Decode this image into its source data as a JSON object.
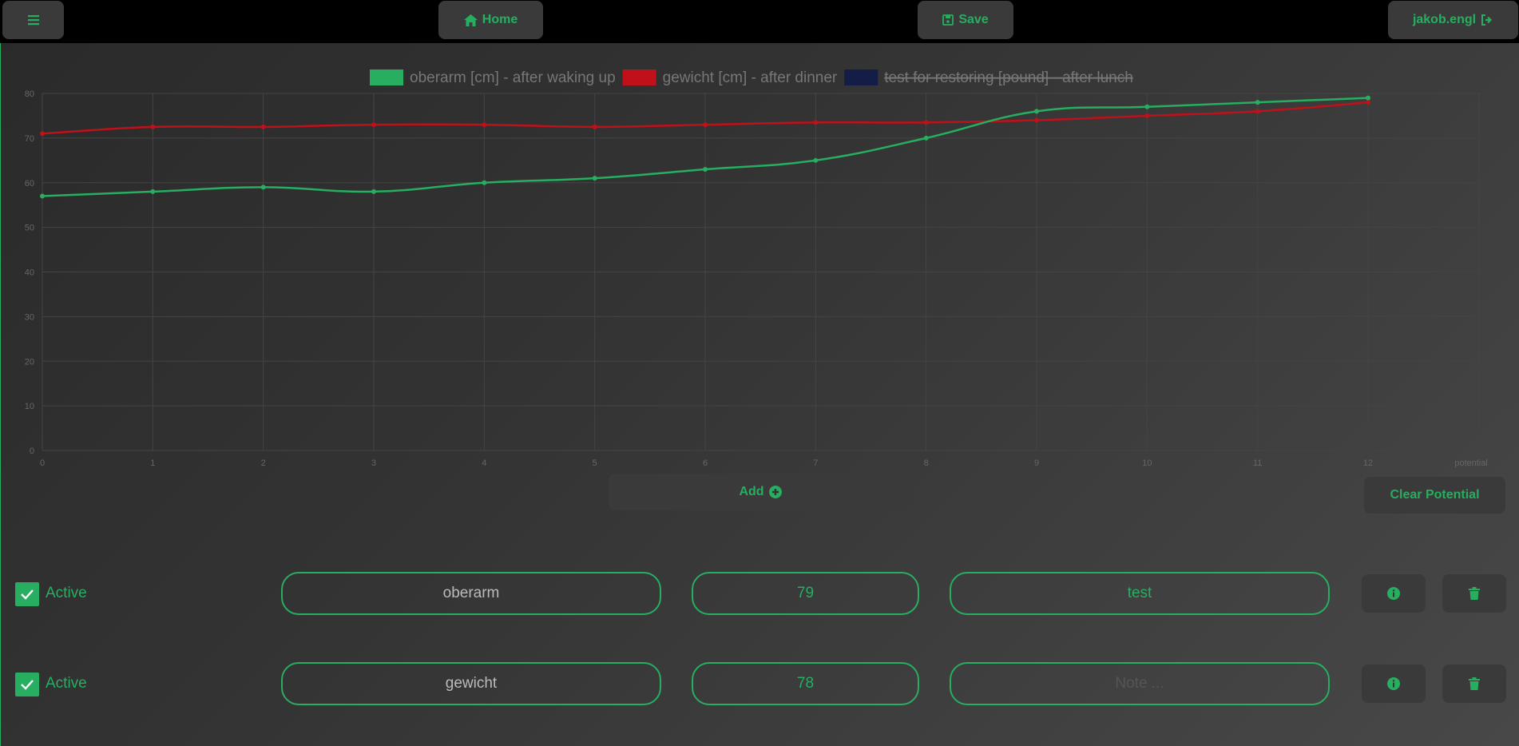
{
  "topbar": {
    "menu_icon": "bars-icon",
    "home_label": "Home",
    "save_label": "Save",
    "user_label": "jakob.engl"
  },
  "chart_data": {
    "type": "line",
    "x": [
      0,
      1,
      2,
      3,
      4,
      5,
      6,
      7,
      8,
      9,
      10,
      11,
      12
    ],
    "xlabel": "potential",
    "ylim": [
      0,
      80
    ],
    "yticks": [
      0,
      10,
      20,
      30,
      40,
      50,
      60,
      70,
      80
    ],
    "grid": true,
    "legend_position": "top",
    "series": [
      {
        "name": "oberarm [cm] - after waking up",
        "color": "#27ae60",
        "hidden": false,
        "values": [
          57,
          58,
          59,
          58,
          60,
          61,
          63,
          65,
          70,
          76,
          77,
          78,
          79
        ]
      },
      {
        "name": "gewicht [cm] - after dinner",
        "color": "#c0101a",
        "hidden": false,
        "values": [
          71,
          72.5,
          72.5,
          73,
          73,
          72.5,
          73,
          73.5,
          73.5,
          74,
          75,
          76,
          78
        ]
      },
      {
        "name": "test for restoring [pound] - after lunch",
        "color": "#131d45",
        "hidden": true,
        "values": []
      }
    ]
  },
  "actions": {
    "add_label": "Add",
    "clear_label": "Clear Potential"
  },
  "rows": [
    {
      "active_label": "Active",
      "name": "oberarm",
      "value": "79",
      "note": "test",
      "note_placeholder": "Note ..."
    },
    {
      "active_label": "Active",
      "name": "gewicht",
      "value": "78",
      "note": "",
      "note_placeholder": "Note ..."
    }
  ]
}
